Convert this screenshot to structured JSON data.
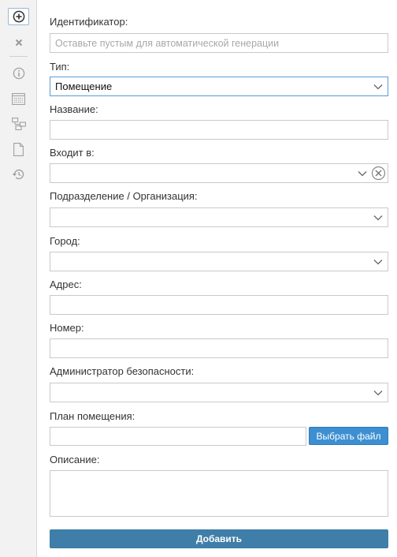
{
  "toolbar": {
    "items": [
      {
        "name": "add-icon"
      },
      {
        "name": "close-icon"
      },
      {
        "name": "info-icon"
      },
      {
        "name": "list-icon"
      },
      {
        "name": "hierarchy-icon"
      },
      {
        "name": "document-icon"
      },
      {
        "name": "history-icon"
      }
    ]
  },
  "form": {
    "id": {
      "label": "Идентификатор:",
      "placeholder": "Оставьте пустым для автоматической генерации",
      "value": ""
    },
    "type": {
      "label": "Тип:",
      "value": "Помещение"
    },
    "name": {
      "label": "Название:",
      "value": ""
    },
    "parent": {
      "label": "Входит в:",
      "value": ""
    },
    "department": {
      "label": "Подразделение / Организация:",
      "value": ""
    },
    "city": {
      "label": "Город:",
      "value": ""
    },
    "address": {
      "label": "Адрес:",
      "value": ""
    },
    "number": {
      "label": "Номер:",
      "value": ""
    },
    "security_admin": {
      "label": "Администратор безопасности:",
      "value": ""
    },
    "plan": {
      "label": "План помещения:",
      "value": "",
      "button_label": "Выбрать файл"
    },
    "description": {
      "label": "Описание:",
      "value": ""
    },
    "submit_label": "Добавить"
  },
  "colors": {
    "accent": "#3d8fd1",
    "submit": "#3f7ea8",
    "focus_border": "#5b9bd5"
  }
}
